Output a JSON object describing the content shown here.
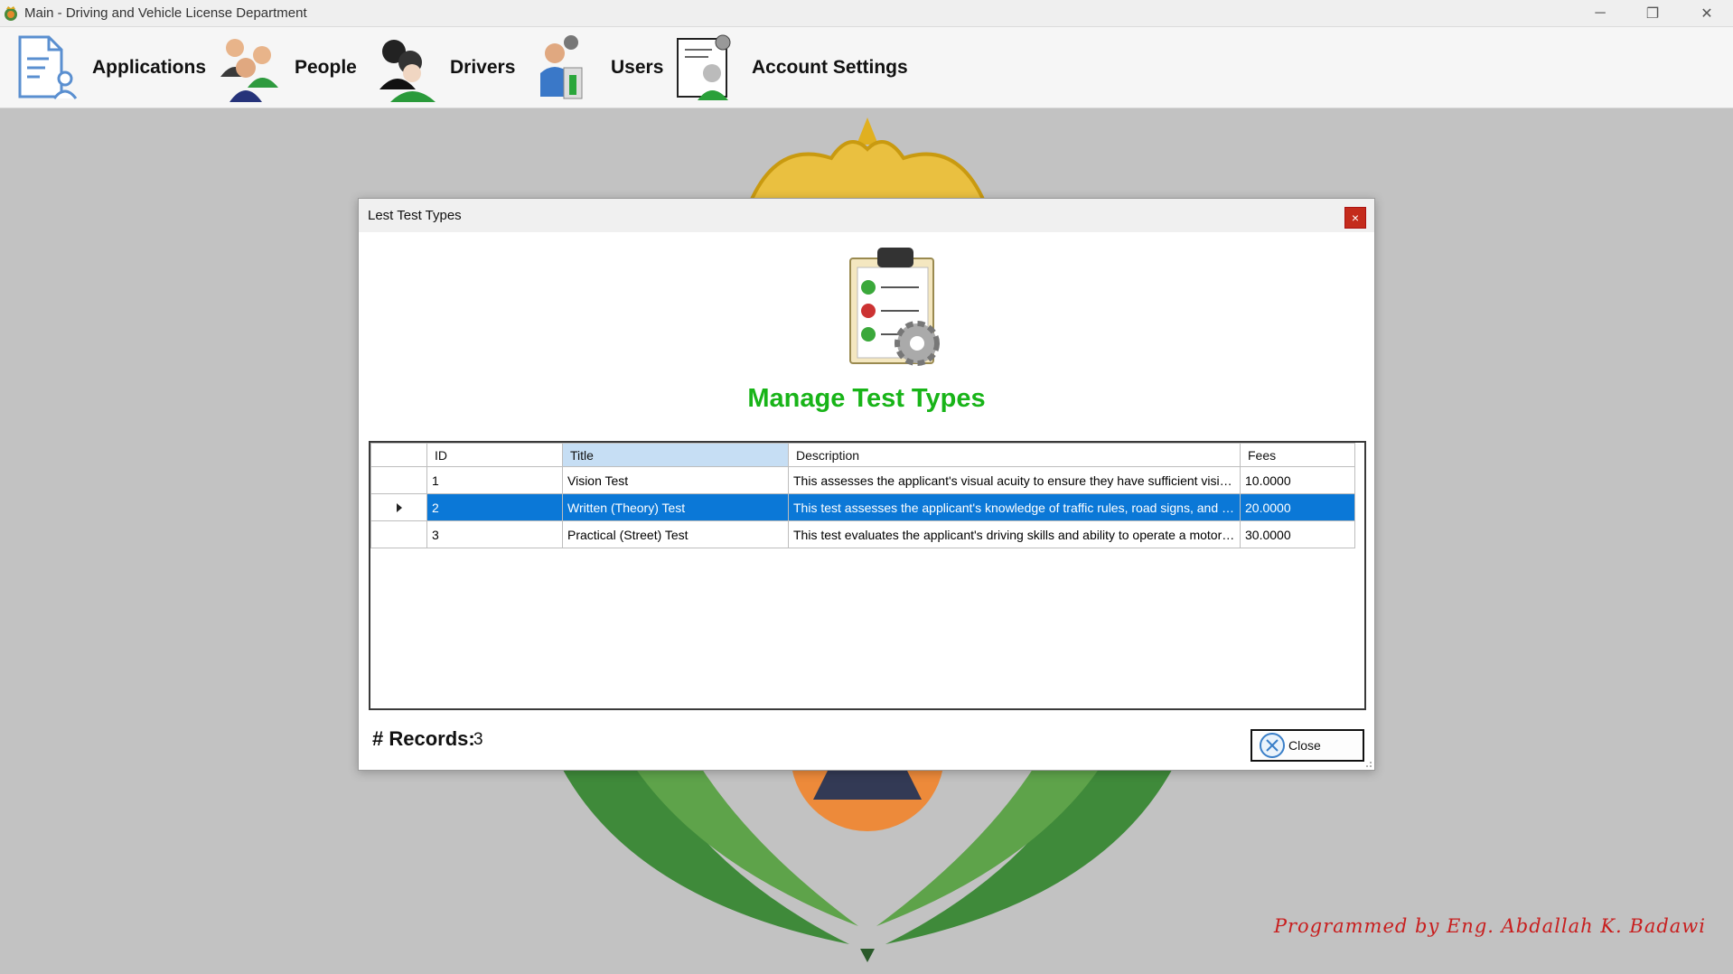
{
  "window": {
    "title": "Main - Driving and Vehicle License Department",
    "minimize_glyph": "─",
    "maximize_glyph": "❐",
    "close_glyph": "✕"
  },
  "menu": {
    "items": [
      {
        "label": "Applications",
        "icon": "document-person-icon"
      },
      {
        "label": "People",
        "icon": "people-group-icon"
      },
      {
        "label": "Drivers",
        "icon": "drivers-icon"
      },
      {
        "label": "Users",
        "icon": "users-settings-icon"
      },
      {
        "label": "Account Settings",
        "icon": "account-settings-icon"
      }
    ]
  },
  "dialog": {
    "title": "Lest Test Types",
    "close_glyph": "×",
    "heading": "Manage Test Types",
    "heading_color": "#18b418",
    "grid": {
      "columns": [
        "ID",
        "Title",
        "Description",
        "Fees"
      ],
      "sorted_column": "Title",
      "rows": [
        {
          "id": "1",
          "title": "Vision Test",
          "description": "This assesses the applicant's visual acuity to ensure they have sufficient vision to...",
          "fees": "10.0000",
          "selected": false
        },
        {
          "id": "2",
          "title": "Written (Theory) Test",
          "description": "This test assesses the applicant's knowledge of traffic rules, road signs, and drivi...",
          "fees": "20.0000",
          "selected": true
        },
        {
          "id": "3",
          "title": "Practical (Street) Test",
          "description": "This test evaluates the applicant's driving skills and ability to operate a motor vehi...",
          "fees": "30.0000",
          "selected": false
        }
      ],
      "selection_color": "#0b78d7"
    },
    "records_label": "# Records:",
    "records_count": "3",
    "close_button_label": "Close"
  },
  "footer": {
    "signature": "Programmed by Eng. Abdallah K. Badawi",
    "signature_color": "#c81e1e"
  }
}
